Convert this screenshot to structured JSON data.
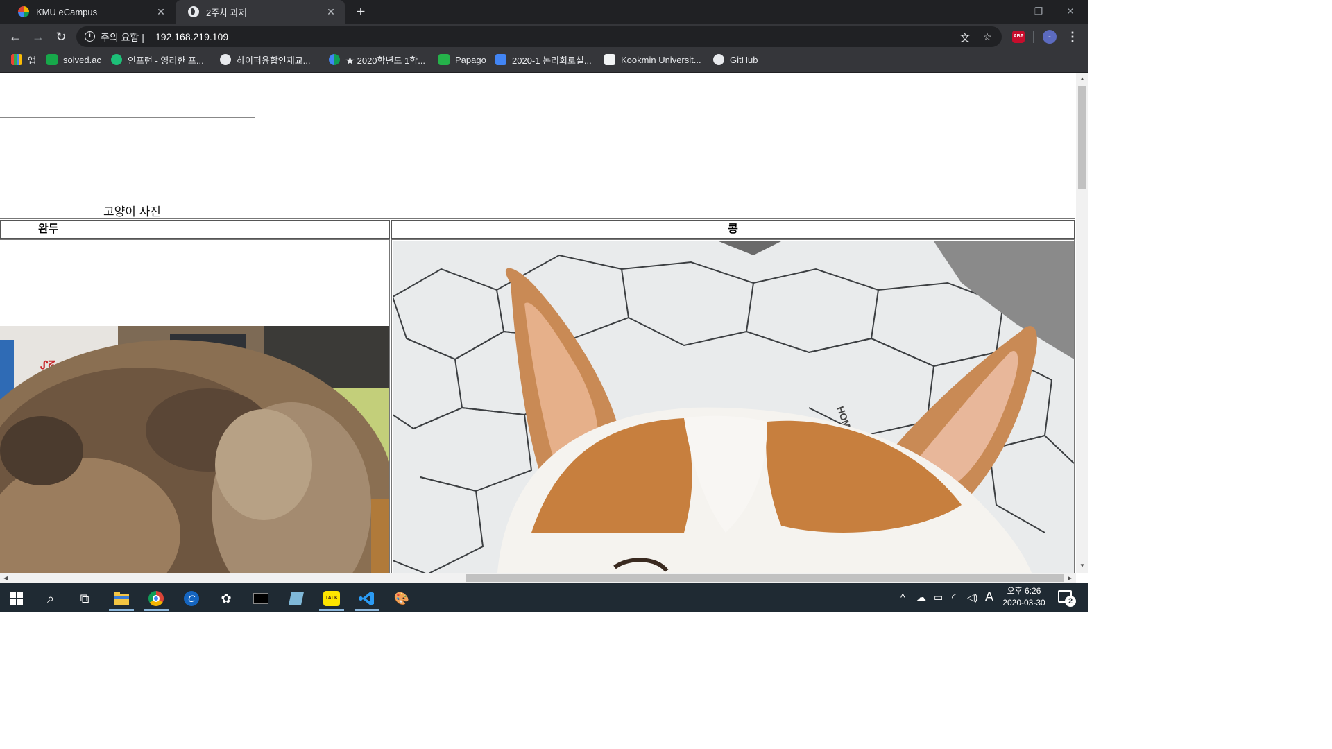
{
  "browser": {
    "tabs": [
      {
        "label": "KMU eCampus"
      },
      {
        "label": "2주차 과제"
      }
    ],
    "new_tab": "+",
    "address": {
      "security_label": "주의 요함",
      "url": "192.168.219.109"
    },
    "profile_initial": "-",
    "bookmarks": [
      {
        "label": "앱",
        "icon": "apps-grid-icon"
      },
      {
        "label": "solved.ac",
        "icon": "solved-ac-icon"
      },
      {
        "label": "인프런 - 영리한 프...",
        "icon": "inflearn-icon"
      },
      {
        "label": "하이퍼융합인재교...",
        "icon": "globe-icon"
      },
      {
        "label": "★ 2020학년도 1학...",
        "icon": "kmu-icon"
      },
      {
        "label": "Papago",
        "icon": "papago-icon"
      },
      {
        "label": "2020-1 논리회로설...",
        "icon": "docs-icon"
      },
      {
        "label": "Kookmin Universit...",
        "icon": "kookmin-icon"
      },
      {
        "label": "GitHub",
        "icon": "github-icon"
      }
    ]
  },
  "page": {
    "caption": "고양이 사진",
    "columns": [
      "완두",
      "콩"
    ]
  },
  "taskbar": {
    "clock_time": "오후 6:26",
    "clock_date": "2020-03-30",
    "ime": "A",
    "notifications": "2"
  }
}
